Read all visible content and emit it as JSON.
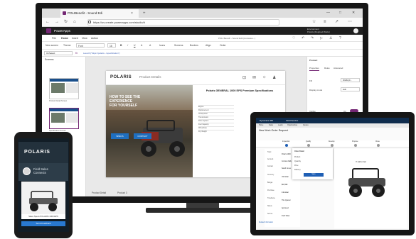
{
  "browser": {
    "tab_title": "POLIBenefit - Sound Edi",
    "tab_close": "×",
    "tab_new": "+",
    "url": "https://us.create.powerapps.com/studio/#",
    "nav": [
      "←",
      "→",
      "↻",
      "⌂"
    ],
    "window_controls": [
      "—",
      "□",
      "✕"
    ]
  },
  "powerapps": {
    "brand": "PowerApps",
    "environment": "Environment\nPolaris (Dogfood Webs)",
    "menus": [
      "File",
      "Home",
      "Insert",
      "View",
      "Action"
    ],
    "active_menu": "Home",
    "app_name": "POLI Benefit - Sound Edit (Autosave...)",
    "ribbon": [
      "New screen",
      "Theme",
      "Font",
      "16",
      "B",
      "/",
      "U",
      "A",
      "A",
      "Icons",
      "Screens",
      "Borders",
      "Align",
      "Order"
    ],
    "property": "OnSelect",
    "fx": "fx",
    "formula": "Launch(\"https://polaris.../specification\")",
    "left_title": "Screens",
    "thumb_labels": [
      "Product Detail Screen",
      "Specification Screen"
    ],
    "right": {
      "title": "Product",
      "tabs": [
        "Properties",
        "Rules",
        "Advanced"
      ],
      "fields": [
        {
          "label": "Fill",
          "value": "RGBA(0..."
        },
        {
          "label": "Display mode",
          "value": "Edit"
        },
        {
          "label": "Visible",
          "value": "On"
        },
        {
          "label": "Position",
          "value": "0    0"
        },
        {
          "label": "Size",
          "value": "1366   768"
        }
      ]
    },
    "bottom_left": "Product Detail",
    "bottom_mid": "Product 3"
  },
  "app": {
    "logo": "POLARIS",
    "page_title": "Product Details",
    "hero_text": "HOW TO SEE THE\nEXPERIENCE\nFOR YOURSELF",
    "hero_btn_1": "SPECS",
    "hero_btn_2": "CONTACT",
    "spec_title": "Polaris GENERAL 1000 EPS Premium Specifications",
    "spec_rows": [
      "Engine",
      "Displacement",
      "Horsepower",
      "Transmission",
      "Drive System",
      "Fuel Capacity",
      "Wheelbase",
      "Dry Weight"
    ]
  },
  "phone": {
    "logo": "POLARIS",
    "subtitle": "Field Sales\nConnects",
    "caption": "Sales Specs POLARIS 1000 EPS",
    "button": "Send Feedback"
  },
  "tablet": {
    "top_left": "Dynamics 365",
    "top_mid": "Field Service",
    "nav": [
      "Home",
      "Sales",
      "Leads",
      "Opportunities",
      "Quotes"
    ],
    "title": "New Work Order Request",
    "steps": [
      "Inspection",
      "Qualify",
      "Develop",
      "Propose",
      "Close"
    ],
    "form_rows": [
      {
        "label": "Topic",
        "value": "Polaris 1000"
      },
      {
        "label": "Account",
        "value": "Contoso Rally"
      },
      {
        "label": "Contact",
        "value": "Sarah Jones"
      },
      {
        "label": "Currency",
        "value": "US Dollar"
      },
      {
        "label": "Budget",
        "value": "$18,999"
      },
      {
        "label": "Purchase",
        "value": "Individual"
      },
      {
        "label": "Timeframe",
        "value": "This Quarter"
      },
      {
        "label": "Status",
        "value": "Approved"
      },
      {
        "label": "Source",
        "value": "Field Sales"
      }
    ],
    "popup_title": "Order Detail",
    "popup_rows": [
      "Product",
      "Quantity",
      "Price",
      "Delivery"
    ],
    "popup_btn": "Save",
    "checkbox": "Add to Cart",
    "bottom": "Related Information"
  },
  "colors": {
    "powerapps": "#742774",
    "polaris_blue": "#1f6fbf",
    "dynamics_navy": "#0f2c4d"
  }
}
